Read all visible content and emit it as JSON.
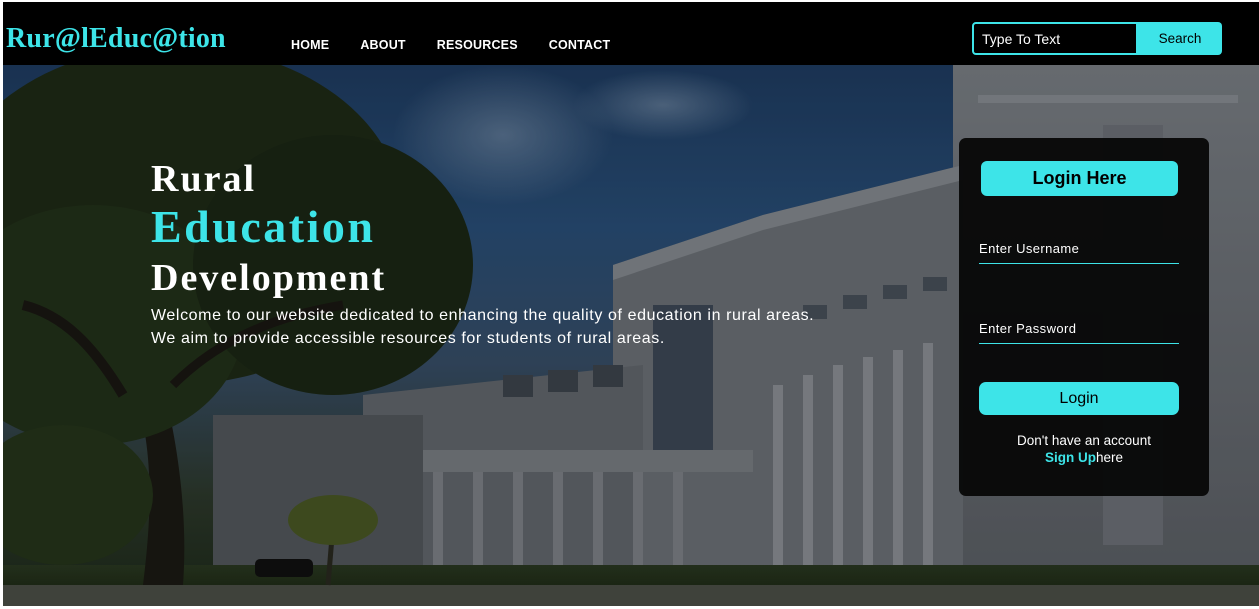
{
  "brand": {
    "logo": "Rur@lEduc@tion"
  },
  "nav": {
    "items": [
      {
        "label": "HOME"
      },
      {
        "label": "ABOUT"
      },
      {
        "label": "RESOURCES"
      },
      {
        "label": "CONTACT"
      }
    ]
  },
  "search": {
    "placeholder": "Type To Text",
    "button_label": "Search"
  },
  "hero": {
    "line1": "Rural",
    "line2": "Education",
    "line3": "Development",
    "para1": "Welcome to our website dedicated to enhancing the quality of education in rural areas.",
    "para2": "We aim to provide accessible resources for students of rural areas."
  },
  "login": {
    "title": "Login Here",
    "username_placeholder": "Enter Username",
    "password_placeholder": "Enter Password",
    "button_label": "Login",
    "no_account_text": "Don't have an account",
    "signup_link": "Sign Up",
    "signup_suffix": "here"
  },
  "colors": {
    "accent": "#3de4e8",
    "navbar_bg": "#000000",
    "panel_bg": "#080808"
  }
}
